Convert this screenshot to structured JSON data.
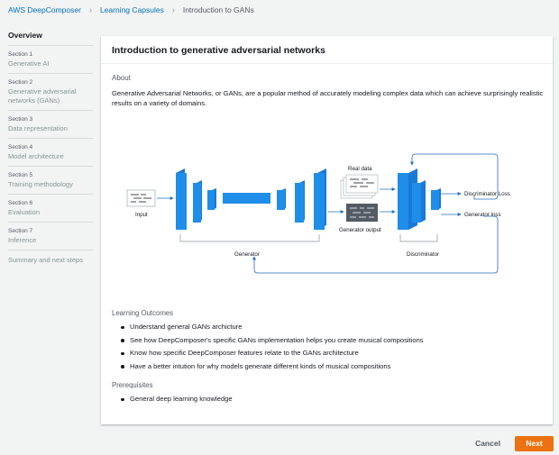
{
  "breadcrumb": {
    "items": [
      "AWS DeepComposer",
      "Learning Capsules",
      "Introduction to GANs"
    ]
  },
  "sidebar": {
    "overview": "Overview",
    "sections": [
      {
        "section": "Section 1",
        "name": "Generative AI"
      },
      {
        "section": "Section 2",
        "name": "Generative adversarial networks (GANs)"
      },
      {
        "section": "Section 3",
        "name": "Data representation"
      },
      {
        "section": "Section 4",
        "name": "Model architecture"
      },
      {
        "section": "Section 5",
        "name": "Training methodology"
      },
      {
        "section": "Section 6",
        "name": "Evaluation"
      },
      {
        "section": "Section 7",
        "name": "Inference"
      }
    ],
    "summary": "Summary and next steps"
  },
  "panel": {
    "title": "Introduction to generative adversarial networks",
    "about_label": "About",
    "about_text": "Generative Adversarial Networks, or GANs, are a popular method of accurately modeling complex data which can achieve surprisingly realistic results on a variety of domains."
  },
  "diagram": {
    "input": "Input",
    "real_data": "Real data",
    "generator_output": "Generator output",
    "generator": "Generator",
    "discriminator": "Discriminator",
    "discriminator_loss": "Discriminator Loss",
    "generator_loss": "Generator loss"
  },
  "outcomes": {
    "label": "Learning Outcomes",
    "items": [
      "Understand general GANs archicture",
      "See how DeepComposer's specific GANs implementation helps you create musical compositions",
      "Know how specific DeepComposer features relate to the GANs architecture",
      "Have a better intution for why models generate different kinds of musical compositions"
    ]
  },
  "prerequisites": {
    "label": "Prerequisites",
    "items": [
      "General deep learning knowledge"
    ]
  },
  "footer": {
    "cancel": "Cancel",
    "next": "Next"
  },
  "colors": {
    "accent": "#0073bb",
    "primary_button": "#ec7211",
    "block_blue": "#1f8ee8"
  }
}
